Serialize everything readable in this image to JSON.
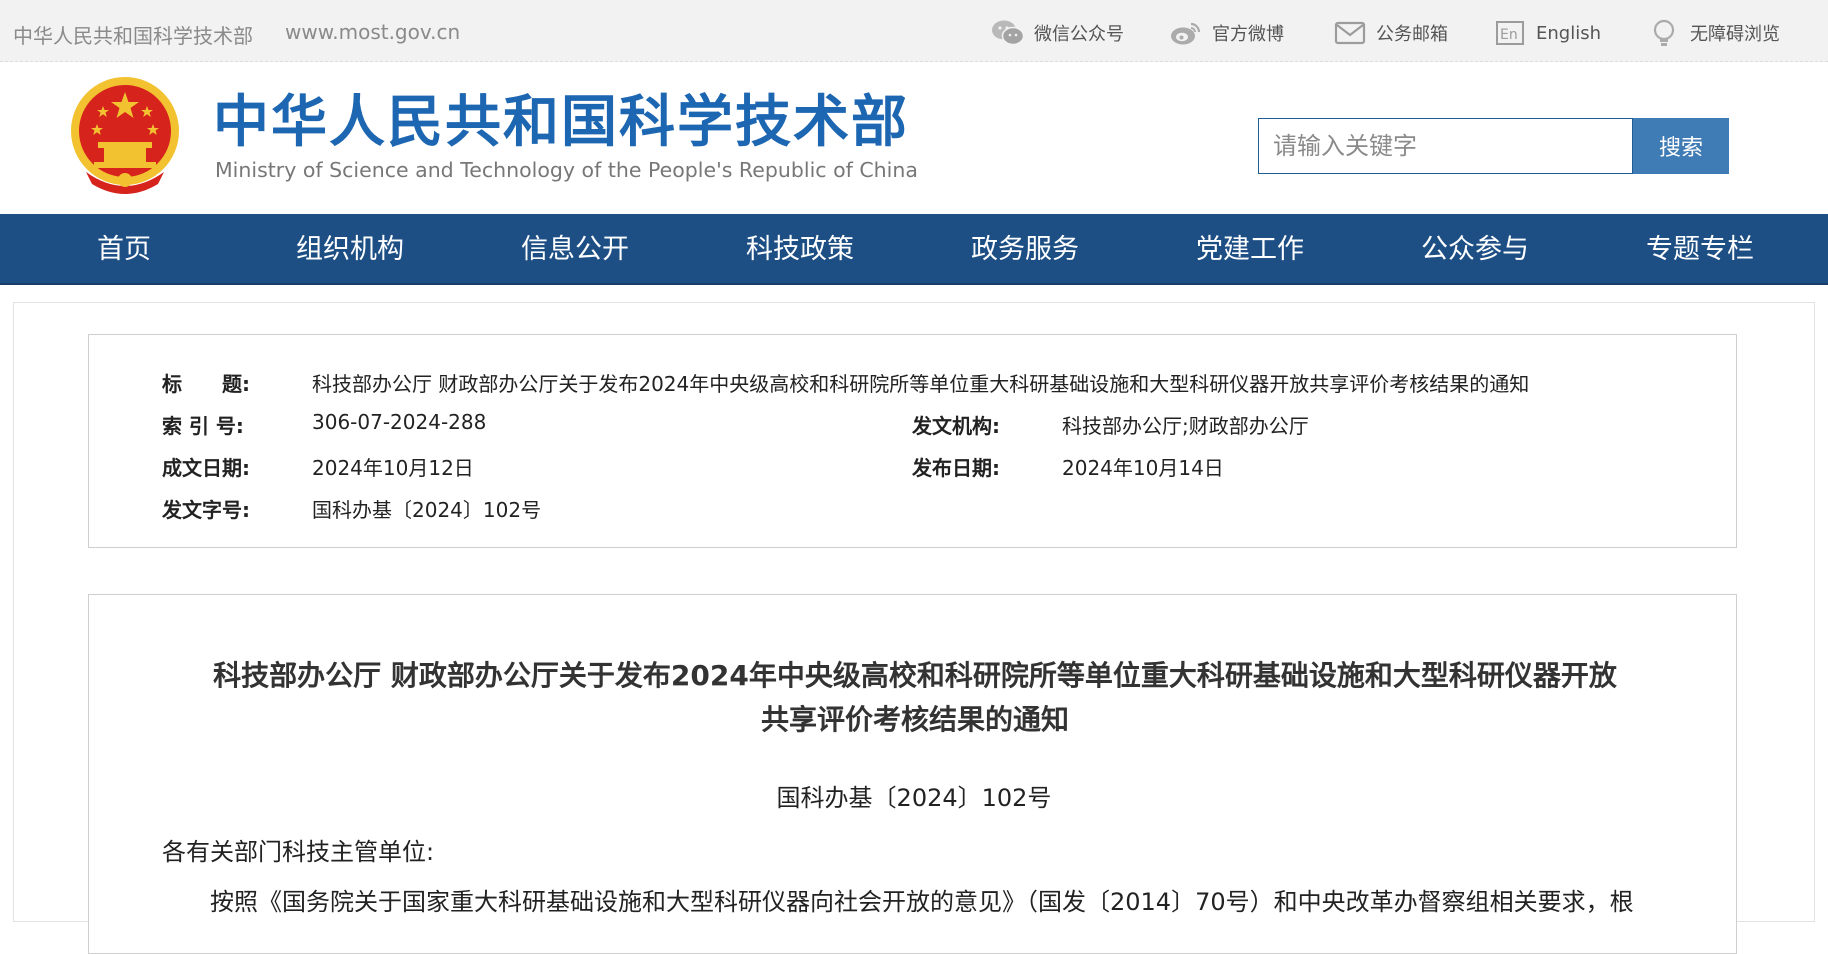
{
  "topbar": {
    "site_name": "中华人民共和国科学技术部",
    "site_url": "www.most.gov.cn",
    "links": [
      {
        "label": "微信公众号",
        "icon": "wechat-icon"
      },
      {
        "label": "官方微博",
        "icon": "weibo-icon"
      },
      {
        "label": "公务邮箱",
        "icon": "mail-icon"
      },
      {
        "label": "English",
        "icon": "english-icon"
      },
      {
        "label": "无障碍浏览",
        "icon": "accessibility-icon"
      }
    ]
  },
  "header": {
    "title_cn": "中华人民共和国科学技术部",
    "title_en": "Ministry of Science and Technology of the People's Republic of China",
    "search_placeholder": "请输入关键字",
    "search_button": "搜索"
  },
  "nav": {
    "items": [
      "首页",
      "组织机构",
      "信息公开",
      "科技政策",
      "政务服务",
      "党建工作",
      "公众参与",
      "专题专栏"
    ]
  },
  "meta": {
    "title_label": "标　　题:",
    "title_value": "科技部办公厅 财政部办公厅关于发布2024年中央级高校和科研院所等单位重大科研基础设施和大型科研仪器开放共享评价考核结果的通知",
    "index_label": "索 引 号:",
    "index_value": "306-07-2024-288",
    "issuer_label": "发文机构:",
    "issuer_value": "科技部办公厅;财政部办公厅",
    "written_label": "成文日期:",
    "written_value": "2024年10月12日",
    "published_label": "发布日期:",
    "published_value": "2024年10月14日",
    "docnum_label": "发文字号:",
    "docnum_value": "国科办基〔2024〕102号"
  },
  "article": {
    "title_line1": "科技部办公厅 财政部办公厅关于发布2024年中央级高校和科研院所等单位重大科研基础设施和大型科研仪器开放",
    "title_line2": "共享评价考核结果的通知",
    "doc_number": "国科办基〔2024〕102号",
    "salutation": "各有关部门科技主管单位:",
    "paragraph_start": "按照《国务院关于国家重大科研基础设施和大型科研仪器向社会开放的意见》（国发〔2014〕70号）和中央改革办督察组相关要求，根"
  },
  "colors": {
    "nav_bg": "#1d4f85",
    "brand_blue": "#1d66b1",
    "search_button": "#3f7bb4",
    "emblem_red": "#d6231c",
    "emblem_gold": "#f2c230"
  }
}
